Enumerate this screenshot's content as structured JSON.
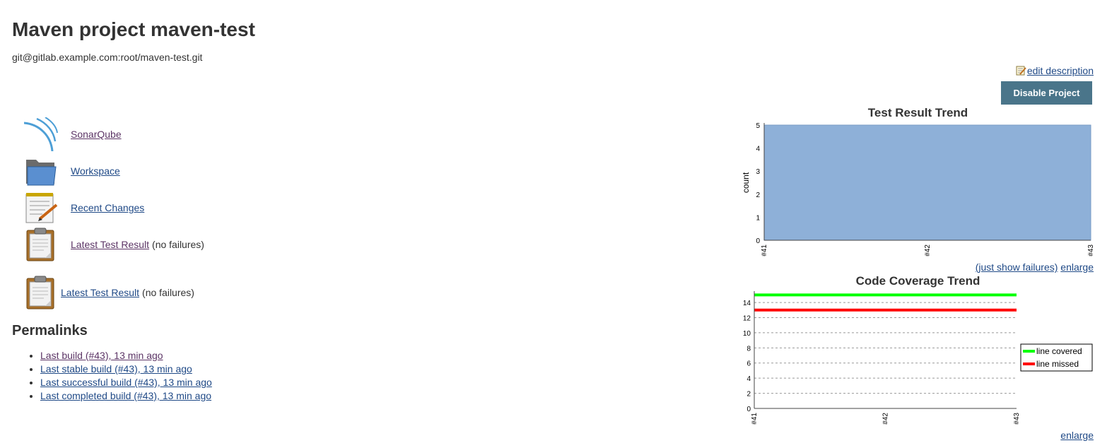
{
  "page": {
    "title": "Maven project maven-test",
    "repo_url": "git@gitlab.example.com:root/maven-test.git",
    "edit_description": "edit description",
    "disable_button": "Disable Project"
  },
  "tasks": [
    {
      "label": "SonarQube",
      "icon": "sonarqube-icon",
      "note": ""
    },
    {
      "label": "Workspace",
      "icon": "folder-icon",
      "note": ""
    },
    {
      "label": "Recent Changes",
      "icon": "notepad-icon",
      "note": ""
    },
    {
      "label": "Latest Test Result",
      "icon": "clipboard-icon",
      "note": "(no failures)"
    },
    {
      "label": "Latest Test Result",
      "icon": "clipboard-icon",
      "note": "(no failures)"
    }
  ],
  "permalinks": {
    "title": "Permalinks",
    "items": [
      "Last build (#43), 13 min ago",
      "Last stable build (#43), 13 min ago",
      "Last successful build (#43), 13 min ago",
      "Last completed build (#43), 13 min ago"
    ]
  },
  "test_trend": {
    "links": {
      "failures": "(just show failures)",
      "enlarge": "enlarge"
    }
  },
  "coverage_trend": {
    "links": {
      "enlarge": "enlarge"
    }
  },
  "colors": {
    "button_bg": "#4a758a",
    "link": "#204a87",
    "visited_link": "#5c3566",
    "test_area": "#8eb0d8",
    "line_covered": "#00ff00",
    "line_missed": "#ff0000"
  },
  "chart_data": [
    {
      "type": "area",
      "title": "Test Result Trend",
      "xlabel": "",
      "ylabel": "count",
      "categories": [
        "#41",
        "#42",
        "#43"
      ],
      "series": [
        {
          "values": [
            5,
            5,
            5
          ]
        }
      ],
      "ylim": [
        0,
        5
      ],
      "yticks": [
        0,
        1,
        2,
        3,
        4,
        5
      ],
      "grid": true,
      "legend": "none"
    },
    {
      "type": "line",
      "title": "Code Coverage Trend",
      "xlabel": "",
      "ylabel": "",
      "categories": [
        "#41",
        "#42",
        "#43"
      ],
      "series": [
        {
          "name": "line covered",
          "values": [
            15,
            15,
            15
          ]
        },
        {
          "name": "line missed",
          "values": [
            13,
            13,
            13
          ]
        }
      ],
      "ylim": [
        0,
        15.5
      ],
      "yticks": [
        0,
        2,
        4,
        6,
        8,
        10,
        12,
        14
      ],
      "grid": true,
      "legend": "right"
    }
  ]
}
